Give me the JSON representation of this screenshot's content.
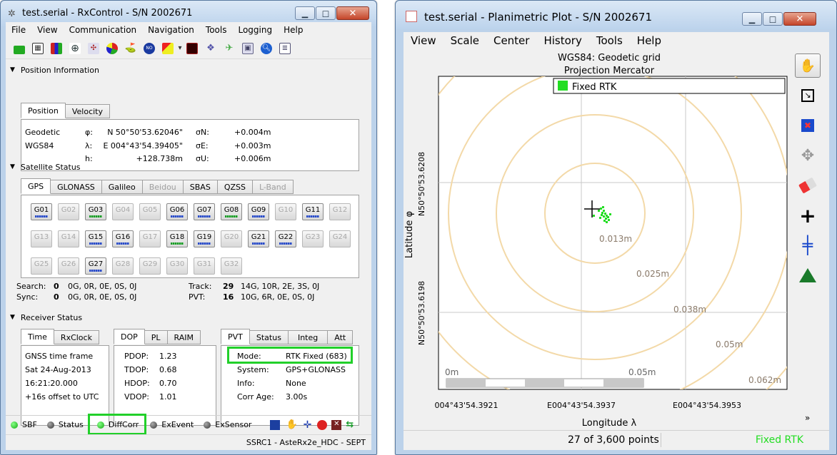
{
  "left": {
    "title": "test.serial - RxControl - S/N 2002671",
    "menu": [
      "File",
      "View",
      "Communication",
      "Navigation",
      "Tools",
      "Logging",
      "Help"
    ],
    "position": {
      "section": "Position Information",
      "tabs": [
        "Position",
        "Velocity"
      ],
      "rows": [
        {
          "label": "Geodetic",
          "sym": "φ:",
          "val": "N 50°50'53.62046\"",
          "sig": "σN:",
          "sv": "+0.004m"
        },
        {
          "label": "WGS84",
          "sym": "λ:",
          "val": "E 004°43'54.39405\"",
          "sig": "σE:",
          "sv": "+0.003m"
        },
        {
          "label": "",
          "sym": "h:",
          "val": "+128.738m",
          "sig": "σU:",
          "sv": "+0.006m"
        }
      ]
    },
    "satellite": {
      "section": "Satellite Status",
      "tabs": [
        "GPS",
        "GLONASS",
        "Galileo",
        "Beidou",
        "SBAS",
        "QZSS",
        "L-Band"
      ],
      "sats": [
        {
          "id": "G01",
          "on": true
        },
        {
          "id": "G02",
          "on": false
        },
        {
          "id": "G03",
          "on": true
        },
        {
          "id": "G04",
          "on": false
        },
        {
          "id": "G05",
          "on": false
        },
        {
          "id": "G06",
          "on": true
        },
        {
          "id": "G07",
          "on": true
        },
        {
          "id": "G08",
          "on": true
        },
        {
          "id": "G09",
          "on": true
        },
        {
          "id": "G10",
          "on": false
        },
        {
          "id": "G11",
          "on": true
        },
        {
          "id": "G12",
          "on": false
        },
        {
          "id": "G13",
          "on": false
        },
        {
          "id": "G14",
          "on": false
        },
        {
          "id": "G15",
          "on": true
        },
        {
          "id": "G16",
          "on": true
        },
        {
          "id": "G17",
          "on": false
        },
        {
          "id": "G18",
          "on": true
        },
        {
          "id": "G19",
          "on": true
        },
        {
          "id": "G20",
          "on": false
        },
        {
          "id": "G21",
          "on": true
        },
        {
          "id": "G22",
          "on": true
        },
        {
          "id": "G23",
          "on": false
        },
        {
          "id": "G24",
          "on": false
        },
        {
          "id": "G25",
          "on": false
        },
        {
          "id": "G26",
          "on": false
        },
        {
          "id": "G27",
          "on": true
        },
        {
          "id": "G28",
          "on": false
        },
        {
          "id": "G29",
          "on": false
        },
        {
          "id": "G30",
          "on": false
        },
        {
          "id": "G31",
          "on": false
        },
        {
          "id": "G32",
          "on": false
        }
      ],
      "search_label": "Search:",
      "search_n": "0",
      "search_v": "0G, 0R, 0E, 0S, 0J",
      "sync_label": "Sync:",
      "sync_n": "0",
      "sync_v": "0G, 0R, 0E, 0S, 0J",
      "track_label": "Track:",
      "track_n": "29",
      "track_v": "14G, 10R, 2E, 3S, 0J",
      "pvt_label": "PVT:",
      "pvt_n": "16",
      "pvt_v": "10G, 6R, 0E, 0S, 0J"
    },
    "receiver": {
      "section": "Receiver Status",
      "time_tabs": [
        "Time",
        "RxClock"
      ],
      "time_lines": [
        "GNSS time frame",
        "Sat 24-Aug-2013",
        "16:21:20.000",
        "+16s offset to UTC"
      ],
      "dop_tabs": [
        "DOP",
        "PL",
        "RAIM"
      ],
      "dop": [
        {
          "k": "PDOP:",
          "v": "1.23"
        },
        {
          "k": "TDOP:",
          "v": "0.68"
        },
        {
          "k": "HDOP:",
          "v": "0.70"
        },
        {
          "k": "VDOP:",
          "v": "1.01"
        }
      ],
      "pvt_tabs": [
        "PVT",
        "Status",
        "Integ",
        "Att"
      ],
      "pvt": [
        {
          "k": "Mode:",
          "v": "RTK Fixed (683)"
        },
        {
          "k": "System:",
          "v": "GPS+GLONASS"
        },
        {
          "k": "Info:",
          "v": "None"
        },
        {
          "k": "Corr Age:",
          "v": "3.00s"
        }
      ]
    },
    "statusbar": {
      "items": [
        "SBF",
        "Status",
        "DiffCorr",
        "ExEvent",
        "ExSensor"
      ],
      "footer": "SSRC1 - AsteRx2e_HDC - SEPT"
    }
  },
  "right": {
    "title": "test.serial - Planimetric Plot - S/N 2002671",
    "menu": [
      "View",
      "Scale",
      "Center",
      "History",
      "Tools",
      "Help"
    ],
    "plot_title": "WGS84: Geodetic grid",
    "plot_subtitle": "Projection Mercator",
    "legend": "Fixed RTK",
    "circles": [
      "0.013m",
      "0.025m",
      "0.038m",
      "0.05m",
      "0.062m"
    ],
    "scale_left": "0m",
    "scale_right": "0.05m",
    "y_ticks": [
      "N50°50'53.6208",
      "N50°50'53.6198"
    ],
    "x_ticks": [
      "004°43'54.3921",
      "E004°43'54.3937",
      "E004°43'54.3953"
    ],
    "ylabel": "Latitude φ",
    "xlabel": "Longitude λ",
    "status_points": "27 of 3,600 points",
    "status_mode": "Fixed RTK",
    "colors": {
      "fix": "#22dd22",
      "ring": "#f3d9a8"
    }
  }
}
